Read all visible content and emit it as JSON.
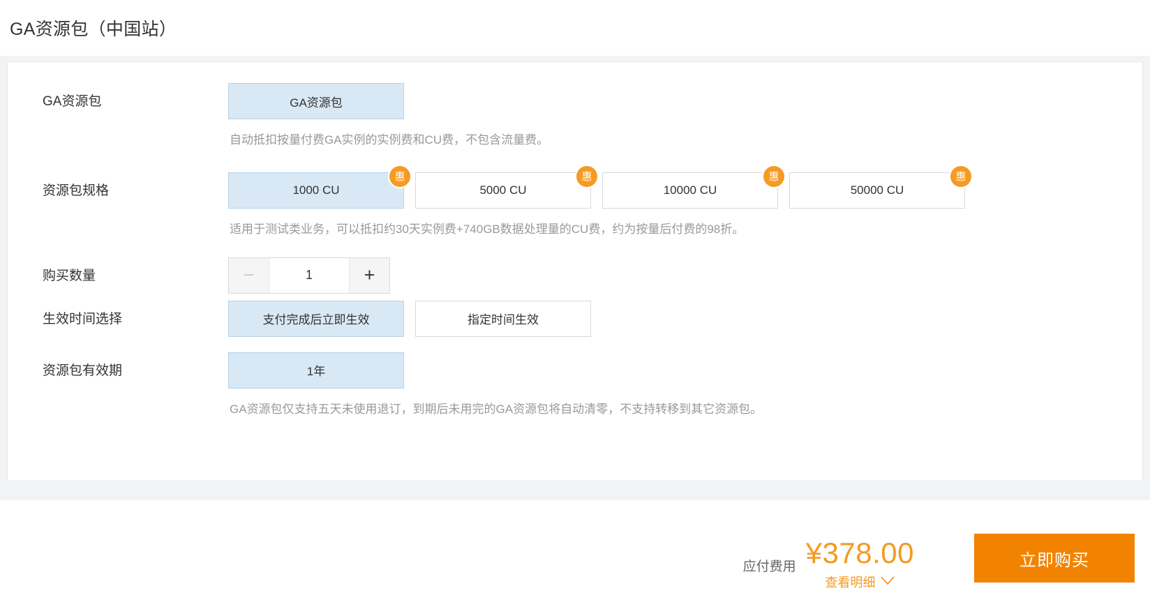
{
  "page": {
    "title": "GA资源包（中国站）"
  },
  "form": {
    "rows": [
      {
        "label": "GA资源包",
        "options": [
          {
            "label": "GA资源包",
            "selected": true,
            "badge": ""
          }
        ],
        "hint": "自动抵扣按量付费GA实例的实例费和CU费，不包含流量费。"
      },
      {
        "label": "资源包规格",
        "options": [
          {
            "label": "1000 CU",
            "selected": true,
            "badge": "惠"
          },
          {
            "label": "5000 CU",
            "selected": false,
            "badge": "惠"
          },
          {
            "label": "10000 CU",
            "selected": false,
            "badge": "惠"
          },
          {
            "label": "50000 CU",
            "selected": false,
            "badge": "惠"
          }
        ],
        "hint": "适用于测试类业务，可以抵扣约30天实例费+740GB数据处理量的CU费，约为按量后付费的98折。"
      },
      {
        "label": "购买数量",
        "quantity": {
          "value": "1",
          "minus_label": "−",
          "plus_label": "+"
        }
      },
      {
        "label": "生效时间选择",
        "options": [
          {
            "label": "支付完成后立即生效",
            "selected": true,
            "badge": ""
          },
          {
            "label": "指定时间生效",
            "selected": false,
            "badge": ""
          }
        ]
      },
      {
        "label": "资源包有效期",
        "options": [
          {
            "label": "1年",
            "selected": true,
            "badge": ""
          }
        ],
        "hint": "GA资源包仅支持五天未使用退订，到期后未用完的GA资源包将自动清零，不支持转移到其它资源包。"
      }
    ]
  },
  "footer": {
    "price_label": "应付费用",
    "price_value": "¥378.00",
    "detail_link": "查看明细",
    "detail_chevron": "⌄",
    "buy_label": "立即购买"
  },
  "colors": {
    "accent_orange": "#f59a23",
    "buy_orange": "#f28300",
    "selected_blue_bg": "#d9e8f5",
    "selected_blue_border": "#b3d2ea"
  }
}
